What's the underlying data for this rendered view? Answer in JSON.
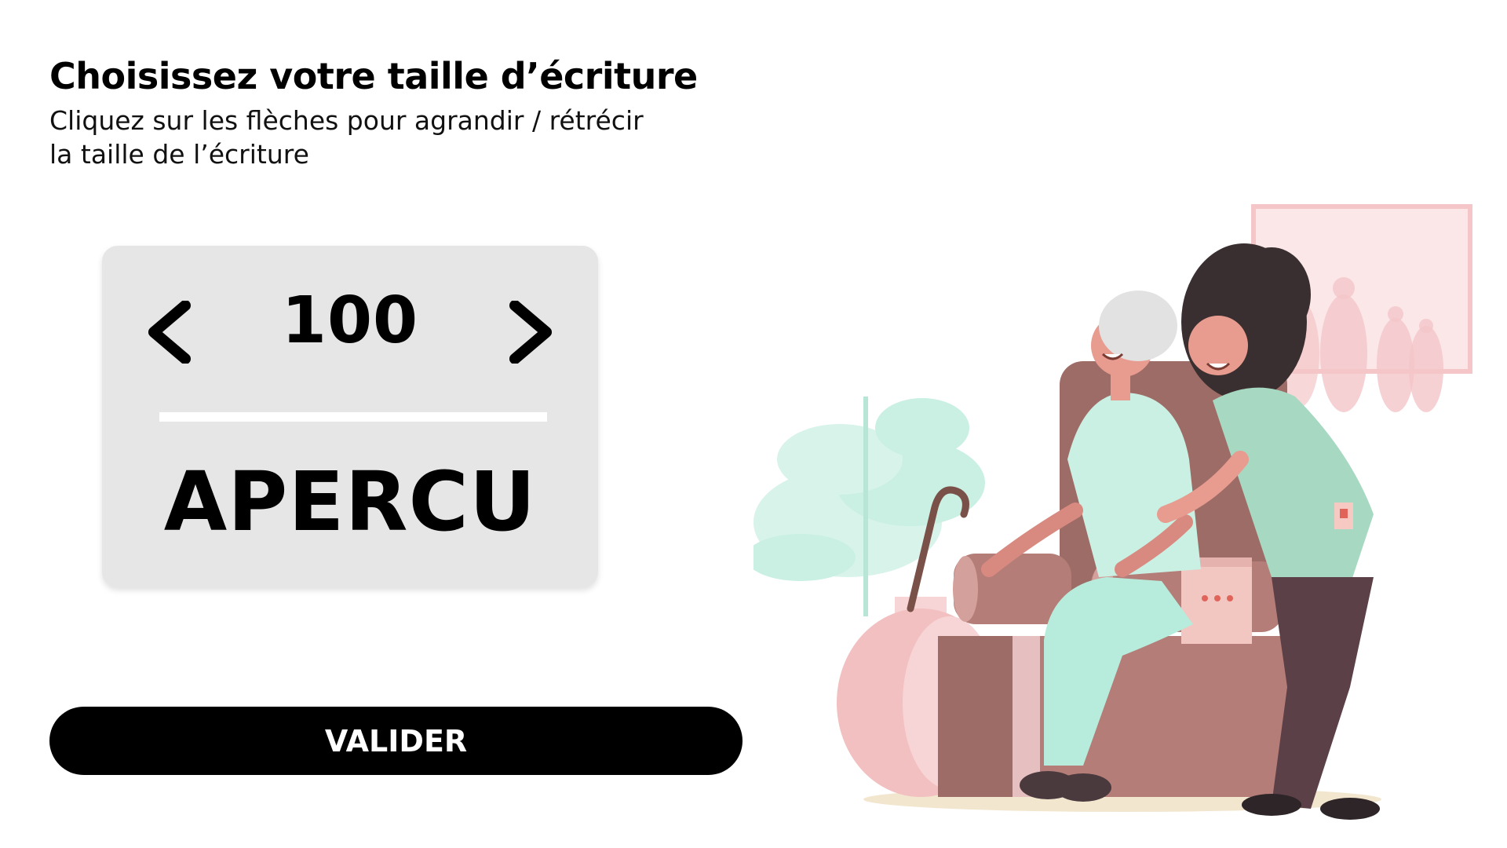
{
  "header": {
    "title": "Choisissez votre taille d’écriture",
    "subtitle_line1": "Cliquez sur les flèches pour agrandir / rétrécir",
    "subtitle_line2": "la taille de l’écriture"
  },
  "size_control": {
    "value": "100",
    "decrease_icon": "chevron-left-icon",
    "increase_icon": "chevron-right-icon"
  },
  "preview": {
    "text": "APERCU"
  },
  "actions": {
    "validate_label": "VALIDER"
  },
  "colors": {
    "background": "#ffffff",
    "card": "#e6e6e6",
    "button": "#000000",
    "button_text": "#ffffff",
    "accent_mint": "#c9f0e3",
    "armchair": "#b47d78",
    "frame_pink": "#f4c6c8"
  }
}
